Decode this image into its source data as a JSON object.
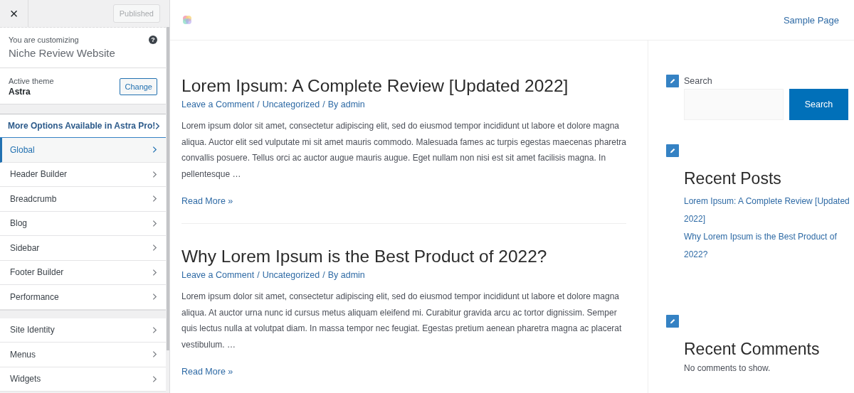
{
  "customizer": {
    "close": "×",
    "publish_button": {
      "label": "Published",
      "disabled": true
    },
    "customizing_label": "You are customizing",
    "site_name": "Niche Review Website",
    "help": "?",
    "theme_label": "Active theme",
    "theme_name": "Astra",
    "change_button": "Change",
    "promo": {
      "label": "More Options Available in Astra Pro!"
    },
    "sections": [
      [
        {
          "label": "Global",
          "selected": true
        },
        {
          "label": "Header Builder",
          "selected": false
        },
        {
          "label": "Breadcrumb",
          "selected": false
        },
        {
          "label": "Blog",
          "selected": false
        },
        {
          "label": "Sidebar",
          "selected": false
        },
        {
          "label": "Footer Builder",
          "selected": false
        },
        {
          "label": "Performance",
          "selected": false
        }
      ],
      [
        {
          "label": "Site Identity",
          "selected": false
        },
        {
          "label": "Menus",
          "selected": false
        },
        {
          "label": "Widgets",
          "selected": false
        }
      ]
    ]
  },
  "preview": {
    "nav": [
      "Sample Page"
    ],
    "posts": [
      {
        "title": "Lorem Ipsum: A Complete Review [Updated 2022]",
        "meta": [
          "Leave a Comment",
          "Uncategorized",
          "By admin"
        ],
        "meta_separator": "/",
        "excerpt": "Lorem ipsum dolor sit amet, consectetur adipiscing elit, sed do eiusmod tempor incididunt ut labore et dolore magna aliqua. Auctor elit sed vulputate mi sit amet mauris commodo. Malesuada fames ac turpis egestas maecenas pharetra convallis posuere. Tellus orci ac auctor augue mauris augue. Eget nullam non nisi est sit amet facilisis magna. In pellentesque …",
        "read_more": "Read More »"
      },
      {
        "title": "Why Lorem Ipsum is the Best Product of 2022?",
        "meta": [
          "Leave a Comment",
          "Uncategorized",
          "By admin"
        ],
        "meta_separator": "/",
        "excerpt": "Lorem ipsum dolor sit amet, consectetur adipiscing elit, sed do eiusmod tempor incididunt ut labore et dolore magna aliqua. At auctor urna nunc id cursus metus aliquam eleifend mi. Curabitur gravida arcu ac tortor dignissim. Semper quis lectus nulla at volutpat diam. In massa tempor nec feugiat. Egestas pretium aenean pharetra magna ac placerat vestibulum. …",
        "read_more": "Read More »"
      }
    ],
    "widgets": [
      {
        "kind": "search",
        "label": "Search",
        "button": "Search"
      },
      {
        "kind": "list",
        "title": "Recent Posts",
        "links": [
          "Lorem Ipsum: A Complete Review [Updated 2022]",
          "Why Lorem Ipsum is the Best Product of 2022?"
        ]
      },
      {
        "kind": "text",
        "title": "Recent Comments",
        "text": "No comments to show."
      }
    ]
  }
}
